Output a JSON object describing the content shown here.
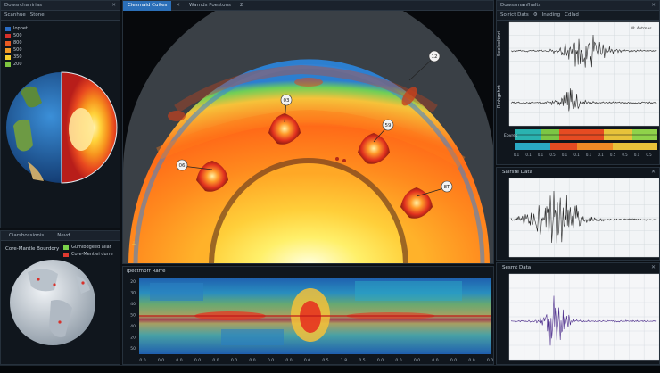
{
  "left_top": {
    "title": "Dowsrchanirias",
    "toolbar": [
      "Scanhue",
      "Stone"
    ],
    "legend": [
      {
        "label": "Iopbet",
        "color": "#2a6cc4"
      },
      {
        "label": "500",
        "color": "#d6302a"
      },
      {
        "label": "800",
        "color": "#e85a22"
      },
      {
        "label": "500",
        "color": "#f09a26"
      },
      {
        "label": "350",
        "color": "#f5cf2f"
      },
      {
        "label": "200",
        "color": "#7fc640"
      }
    ]
  },
  "left_bottom": {
    "tabs": [
      "Ciarsbossionis",
      "Nevd"
    ],
    "title": "Core-Mantle Bourdory",
    "legend": [
      {
        "label": "Gumibdgeed aliar",
        "color": "#7bd24a"
      },
      {
        "label": "Core-Mentlei durre",
        "color": "#e03a30"
      }
    ]
  },
  "main": {
    "tabs": [
      {
        "label": "Ciesmaid Cuites",
        "active": true
      },
      {
        "label": "Warnds Poestons",
        "active": false
      }
    ],
    "tab_counts": [
      "2"
    ],
    "hotspots": [
      {
        "label": "03",
        "cx": 318,
        "cy": 155
      },
      {
        "label": "59",
        "cx": 418,
        "cy": 177
      },
      {
        "label": "06",
        "cx": 237,
        "cy": 208
      },
      {
        "label": "8T",
        "cx": 466,
        "cy": 238
      },
      {
        "label": "12",
        "cx": 458,
        "cy": 108
      }
    ]
  },
  "spectro": {
    "title": "Ipectmprr Rarre",
    "y_ticks": [
      "20",
      "30",
      "40",
      "50",
      "40",
      "20",
      "50"
    ],
    "x_ticks": [
      "0.0",
      "0.0",
      "0.0",
      "0.0",
      "0.0",
      "0.0",
      "0.0",
      "0.0",
      "0.0",
      "0.0",
      "0.5",
      "1.8",
      "0.5",
      "0.0",
      "0.0",
      "0.0",
      "0.0",
      "0.0",
      "0.0",
      "0.0"
    ]
  },
  "right_top": {
    "title": "Dowssmanfhalts",
    "toolbar": [
      "Solrict Dats",
      "Inading",
      "Cdlad"
    ],
    "trace1_label": "Seelboltinri",
    "trace2_label": "Rinhgehnt",
    "trace1_note": "M: Avtmas",
    "colorbar_label": "Ebvres",
    "colorbar_ticks": [
      "0.1",
      "0.1",
      "0.1",
      "0.5",
      "0.1",
      "0.1",
      "0.1",
      "0.1",
      "0.5",
      "0.5",
      "0.1",
      "0.5"
    ]
  },
  "right_mid": {
    "title": "Sairste Data"
  },
  "right_bot": {
    "title": "Sesmt Data"
  },
  "colors": {
    "accent": "#2b6fb8",
    "panel": "#10161d",
    "header": "#1a222c"
  }
}
